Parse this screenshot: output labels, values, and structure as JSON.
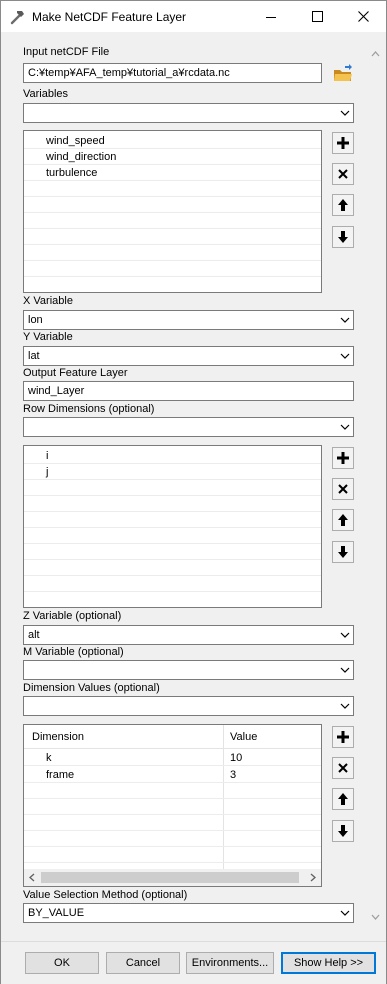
{
  "window": {
    "title": "Make NetCDF Feature Layer"
  },
  "labels": {
    "input_file": "Input netCDF File",
    "variables": "Variables",
    "x_variable": "X Variable",
    "y_variable": "Y Variable",
    "output_layer": "Output Feature Layer",
    "row_dimensions": "Row Dimensions (optional)",
    "z_variable": "Z Variable (optional)",
    "m_variable": "M Variable (optional)",
    "dimension_values": "Dimension Values (optional)",
    "value_selection": "Value Selection Method (optional)"
  },
  "values": {
    "input_file": "C:¥temp¥AFA_temp¥tutorial_a¥rcdata.nc",
    "variables": "",
    "x_variable": "lon",
    "y_variable": "lat",
    "output_layer": "wind_Layer",
    "row_dimensions": "",
    "z_variable": "alt",
    "m_variable": "",
    "dimension_values": "",
    "value_selection": "BY_VALUE"
  },
  "variables_list": [
    "wind_speed",
    "wind_direction",
    "turbulence"
  ],
  "row_dimensions_list": [
    "i",
    "j"
  ],
  "dimension_table": {
    "headers": [
      "Dimension",
      "Value"
    ],
    "rows": [
      {
        "dimension": "k",
        "value": "10"
      },
      {
        "dimension": "frame",
        "value": "3"
      }
    ]
  },
  "buttons": {
    "ok": "OK",
    "cancel": "Cancel",
    "environments": "Environments...",
    "show_help": "Show Help >>"
  },
  "icons": {
    "add": "plus-icon",
    "remove": "x-icon",
    "up": "arrow-up-icon",
    "down": "arrow-down-icon",
    "browse": "folder-icon"
  },
  "colors": {
    "accent": "#0078d7",
    "folder": "#e8b23a"
  }
}
